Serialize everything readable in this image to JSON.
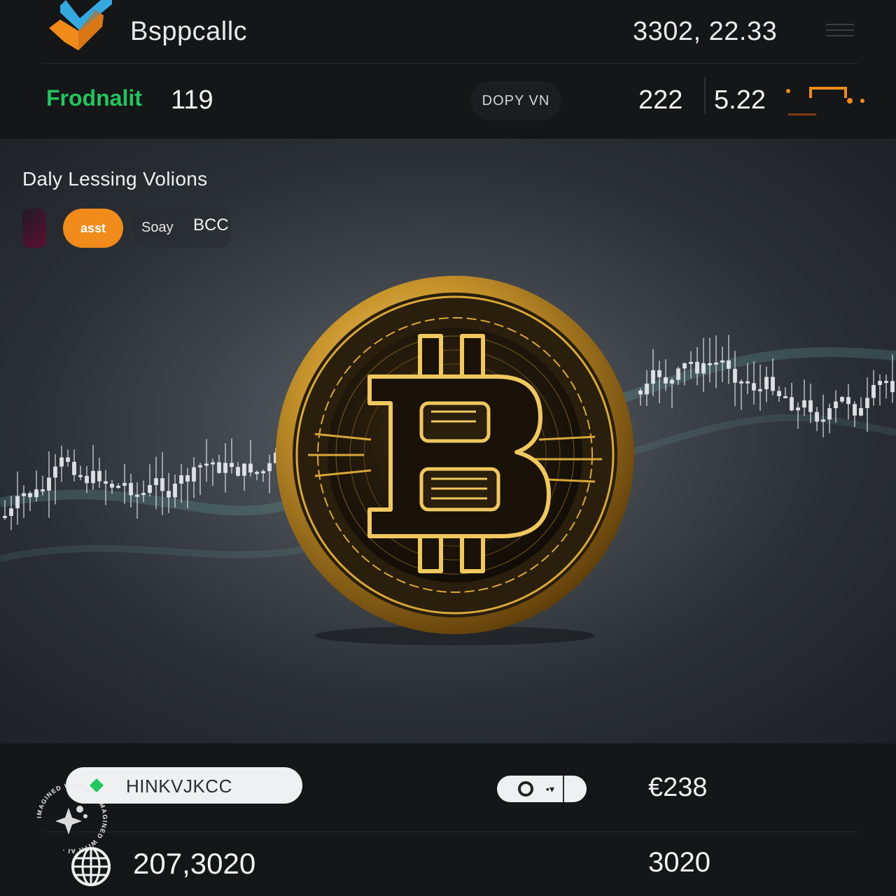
{
  "header": {
    "brand": "Bsppcallc",
    "price": "3302, 22.33",
    "stat_label": "Frodnalit",
    "stat_count": "119",
    "pill_button": "DOPY VN",
    "stat_a": "222",
    "stat_b": "5.22"
  },
  "main": {
    "title": "Daly Lessing Volions",
    "chips": [
      "asst",
      "Soay",
      "BCC"
    ]
  },
  "footer": {
    "search_text": "HINKVJKCC",
    "value_top": "€238",
    "value_left": "207,3020",
    "value_right": "3020"
  },
  "watermark": {
    "text": "IMAGINED WITH AI · IMAGINED WITH AI ·"
  },
  "colors": {
    "accent_orange": "#f08b1c",
    "accent_green": "#22c55e",
    "accent_blue": "#35a8e0",
    "gold": "#d8a83a",
    "background": "#151618"
  },
  "icons": {
    "logo": "check-shield-icon",
    "menu": "hamburger-menu-icon",
    "spark": "trend-line-icon",
    "search_gem": "diamond-icon",
    "globe": "globe-icon",
    "coin": "bitcoin-coin-icon"
  }
}
